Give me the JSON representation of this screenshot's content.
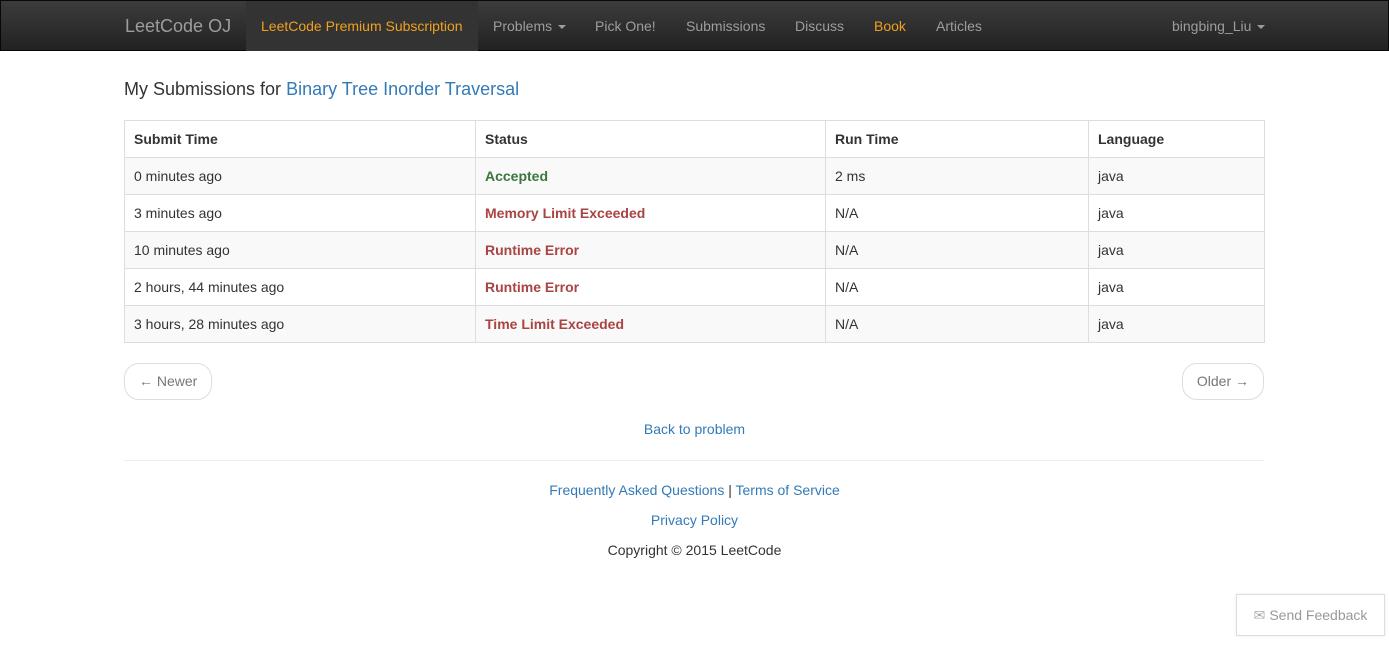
{
  "navbar": {
    "brand": "LeetCode OJ",
    "premium": "LeetCode Premium Subscription",
    "problems": "Problems",
    "pick_one": "Pick One!",
    "submissions": "Submissions",
    "discuss": "Discuss",
    "book": "Book",
    "articles": "Articles",
    "user": "bingbing_Liu"
  },
  "page": {
    "heading_prefix": "My Submissions for",
    "problem_title": "Binary Tree Inorder Traversal"
  },
  "table": {
    "headers": [
      "Submit Time",
      "Status",
      "Run Time",
      "Language"
    ],
    "rows": [
      {
        "time": "0 minutes ago",
        "status": "Accepted",
        "status_kind": "ok",
        "runtime": "2 ms",
        "language": "java"
      },
      {
        "time": "3 minutes ago",
        "status": "Memory Limit Exceeded",
        "status_kind": "bad",
        "runtime": "N/A",
        "language": "java"
      },
      {
        "time": "10 minutes ago",
        "status": "Runtime Error",
        "status_kind": "bad",
        "runtime": "N/A",
        "language": "java"
      },
      {
        "time": "2 hours, 44 minutes ago",
        "status": "Runtime Error",
        "status_kind": "bad",
        "runtime": "N/A",
        "language": "java"
      },
      {
        "time": "3 hours, 28 minutes ago",
        "status": "Time Limit Exceeded",
        "status_kind": "bad",
        "runtime": "N/A",
        "language": "java"
      }
    ]
  },
  "pager": {
    "newer": "← Newer",
    "older": "Older →"
  },
  "back_link": "Back to problem",
  "footer": {
    "faq": "Frequently Asked Questions",
    "separator": "|",
    "terms": "Terms of Service",
    "privacy": "Privacy Policy",
    "copyright": "Copyright © 2015 LeetCode"
  },
  "feedback": {
    "label": "Send Feedback",
    "icon": "envelope-icon"
  },
  "colors": {
    "accent": "#f0a020",
    "link": "#337ab7",
    "accepted": "#3c763d",
    "error": "#a94442"
  }
}
